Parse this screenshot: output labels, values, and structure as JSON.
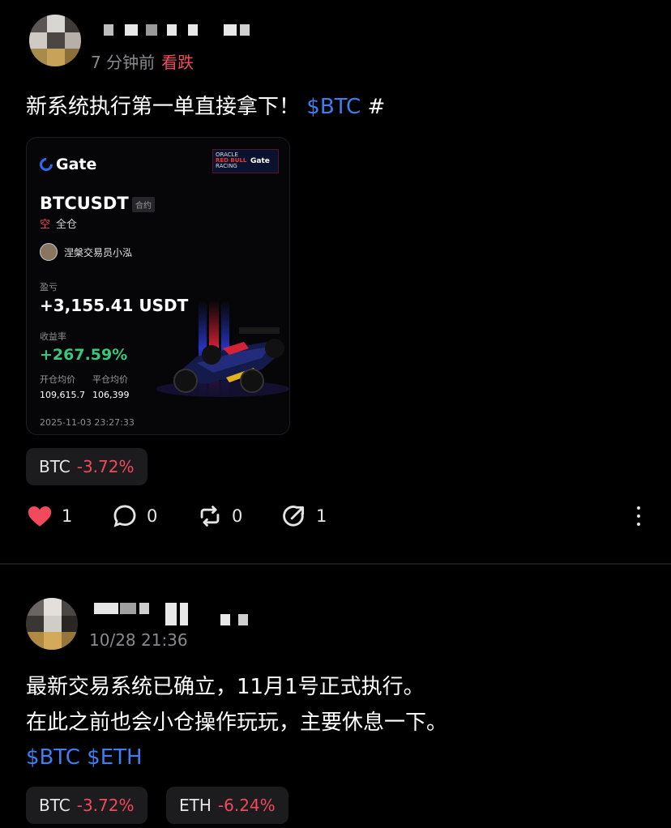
{
  "post1": {
    "time": "7 分钟前",
    "sentiment_tag": "看跌",
    "text": "新系统执行第一单直接拿下！",
    "cashtag": "$BTC",
    "hash": "#",
    "card": {
      "brand": "Gate",
      "badge_line1": "ORACLE",
      "badge_line2": "RED BULL",
      "badge_line3": "RACING",
      "badge_brand": "Gate",
      "symbol": "BTCUSDT",
      "symbol_tag": "合约",
      "side": "空",
      "margin_mode": "全仓",
      "trader": "涅槃交易员小泓",
      "pnl_label": "盈亏",
      "pnl_value": "+3,155.41 USDT",
      "roi_label": "收益率",
      "roi_value": "+267.59%",
      "open_label": "开仓均价",
      "close_label": "平仓均价",
      "open_price": "109,615.7",
      "close_price": "106,399",
      "timestamp": "2025-11-03 23:27:33"
    },
    "tickers": [
      {
        "symbol": "BTC",
        "change": "-3.72%"
      }
    ],
    "actions": {
      "likes": "1",
      "comments": "0",
      "reposts": "0",
      "shares": "1"
    }
  },
  "post2": {
    "time": "10/28 21:36",
    "line1": "最新交易系统已确立，11月1号正式执行。",
    "line2": "在此之前也会小仓操作玩玩，主要休息一下。",
    "cashtags": "$BTC $ETH",
    "tickers": [
      {
        "symbol": "BTC",
        "change": "-3.72%"
      },
      {
        "symbol": "ETH",
        "change": "-6.24%"
      }
    ]
  },
  "icons": {
    "like": "heart-icon",
    "comment": "comment-bubble-icon",
    "repost": "repost-icon",
    "share": "share-icon",
    "more": "more-vertical-icon"
  },
  "colors": {
    "negative": "#f2495c",
    "positive": "#38c77c",
    "link": "#3d7ef0",
    "like": "#f2495c"
  }
}
